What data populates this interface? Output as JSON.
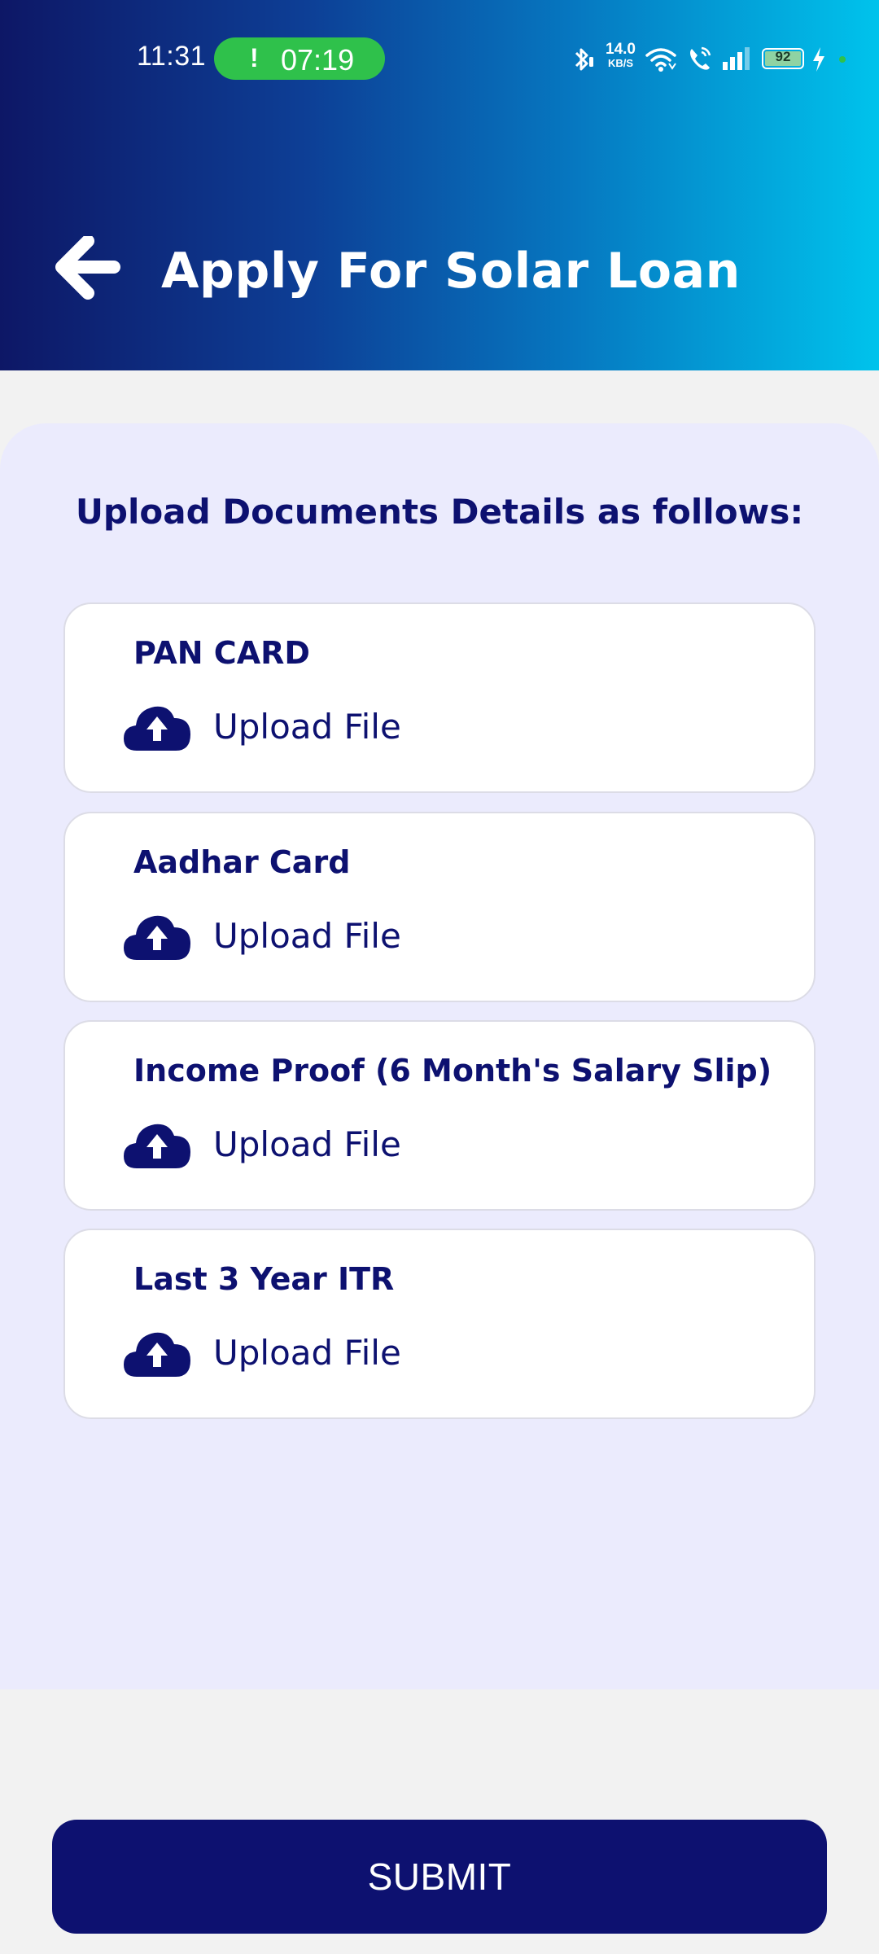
{
  "status_bar": {
    "time": "11:31",
    "call_indicator": "!",
    "call_duration": "07:19",
    "network_speed_value": "14.0",
    "network_speed_unit": "KB/S",
    "battery_level": "92"
  },
  "header": {
    "title": "Apply For Solar Loan",
    "back_icon": "arrow-left-icon"
  },
  "main": {
    "heading": "Upload Documents Details as follows:",
    "documents": [
      {
        "title": "PAN CARD",
        "upload_label": "Upload File"
      },
      {
        "title": "Aadhar Card",
        "upload_label": "Upload File"
      },
      {
        "title": "Income Proof (6 Month's Salary Slip)",
        "upload_label": "Upload File"
      },
      {
        "title": "Last 3 Year ITR",
        "upload_label": "Upload File"
      }
    ]
  },
  "footer": {
    "submit_label": "SUBMIT"
  },
  "colors": {
    "primary": "#0d1170",
    "panel_background": "#ebebfd",
    "page_background": "#f2f2f2",
    "gradient_start": "#0d1766",
    "gradient_end": "#00c3ec",
    "call_pill": "#2fc14b"
  }
}
